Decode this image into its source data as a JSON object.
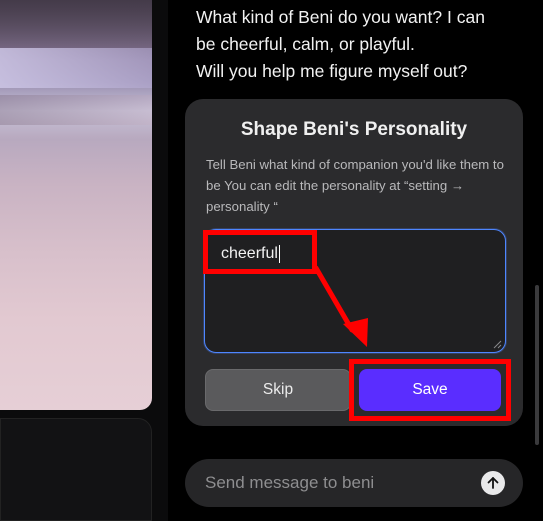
{
  "chat": {
    "message_lines": [
      "What kind of Beni do you want? I can",
      "be cheerful, calm, or playful.",
      "Will you help me figure myself out?"
    ]
  },
  "card": {
    "title": "Shape Beni's Personality",
    "description": "Tell Beni what kind of companion you'd like them to be You can edit the personality at “setting → personality “",
    "input_value": "cheerful",
    "skip_label": "Skip",
    "save_label": "Save"
  },
  "composer": {
    "placeholder": "Send message to beni",
    "send_icon": "arrow-up-icon"
  },
  "colors": {
    "accent": "#5a2dff",
    "focus_border": "#4e86ff",
    "annotation": "#ff0000"
  }
}
